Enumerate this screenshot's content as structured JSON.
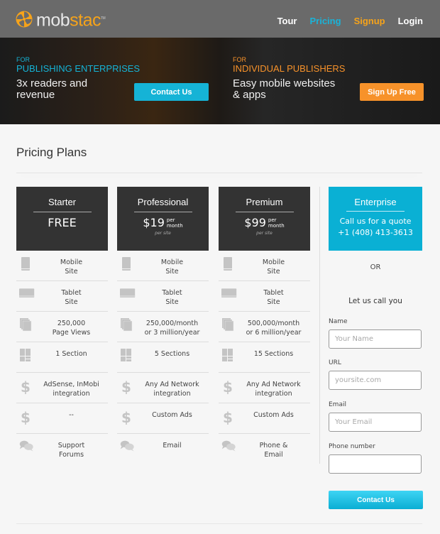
{
  "header": {
    "logo": {
      "prefix": "mob",
      "accent": "stac",
      "tm": "TM"
    },
    "nav": [
      {
        "label": "Tour",
        "color": "#ffffff"
      },
      {
        "label": "Pricing",
        "color": "#1ab3d8"
      },
      {
        "label": "Signup",
        "color": "#f6a31a"
      },
      {
        "label": "Login",
        "color": "#ffffff"
      }
    ]
  },
  "hero": {
    "enterprise": {
      "for": "FOR",
      "heading": "PUBLISHING ENTERPRISES",
      "subtitle_line1": "3x readers and",
      "subtitle_line2": "revenue",
      "button": "Contact Us",
      "color": "#15b3d6"
    },
    "individual": {
      "for": "FOR",
      "heading": "INDIVIDUAL PUBLISHERS",
      "subtitle_line1": "Easy mobile websites",
      "subtitle_line2": "& apps",
      "button": "Sign Up Free",
      "color": "#f7922a"
    }
  },
  "page_title": "Pricing Plans",
  "plans": [
    {
      "name": "Starter",
      "price": "FREE",
      "per": "",
      "month": "",
      "per_site": "",
      "features": [
        [
          "Mobile",
          "Site"
        ],
        [
          "Tablet",
          "Site"
        ],
        [
          "250,000",
          "Page Views"
        ],
        [
          "1 Section",
          ""
        ],
        [
          "AdSense, InMobi",
          "integration"
        ],
        [
          "--",
          ""
        ],
        [
          "Support",
          "Forums"
        ]
      ]
    },
    {
      "name": "Professional",
      "price": "$19",
      "per": "per",
      "month": "month",
      "per_site": "per site",
      "features": [
        [
          "Mobile",
          "Site"
        ],
        [
          "Tablet",
          "Site"
        ],
        [
          "250,000/month",
          "or 3 million/year"
        ],
        [
          "5 Sections",
          ""
        ],
        [
          "Any Ad Network",
          "integration"
        ],
        [
          "Custom Ads",
          ""
        ],
        [
          "Email",
          ""
        ]
      ]
    },
    {
      "name": "Premium",
      "price": "$99",
      "per": "per",
      "month": "month",
      "per_site": "per site",
      "features": [
        [
          "Mobile",
          "Site"
        ],
        [
          "Tablet",
          "Site"
        ],
        [
          "500,000/month",
          "or 6 million/year"
        ],
        [
          "15 Sections",
          ""
        ],
        [
          "Any Ad Network",
          "integration"
        ],
        [
          "Custom Ads",
          ""
        ],
        [
          "Phone &",
          "Email"
        ]
      ]
    }
  ],
  "feature_icons": [
    "mobile-icon",
    "tablet-icon",
    "pages-icon",
    "sections-icon",
    "dollar-icon",
    "dollar-icon",
    "chat-icon"
  ],
  "enterprise": {
    "name": "Enterprise",
    "line1": "Call us for a quote",
    "phone": "+1 (408) 413-3613",
    "or": "OR",
    "callback_title": "Let us call you"
  },
  "form": {
    "name": {
      "label": "Name",
      "placeholder": "Your Name",
      "value": ""
    },
    "url": {
      "label": "URL",
      "placeholder": "yoursite.com",
      "value": ""
    },
    "email": {
      "label": "Email",
      "placeholder": "Your Email",
      "value": ""
    },
    "phone": {
      "label": "Phone number",
      "placeholder": "",
      "value": ""
    },
    "submit": "Contact Us"
  }
}
